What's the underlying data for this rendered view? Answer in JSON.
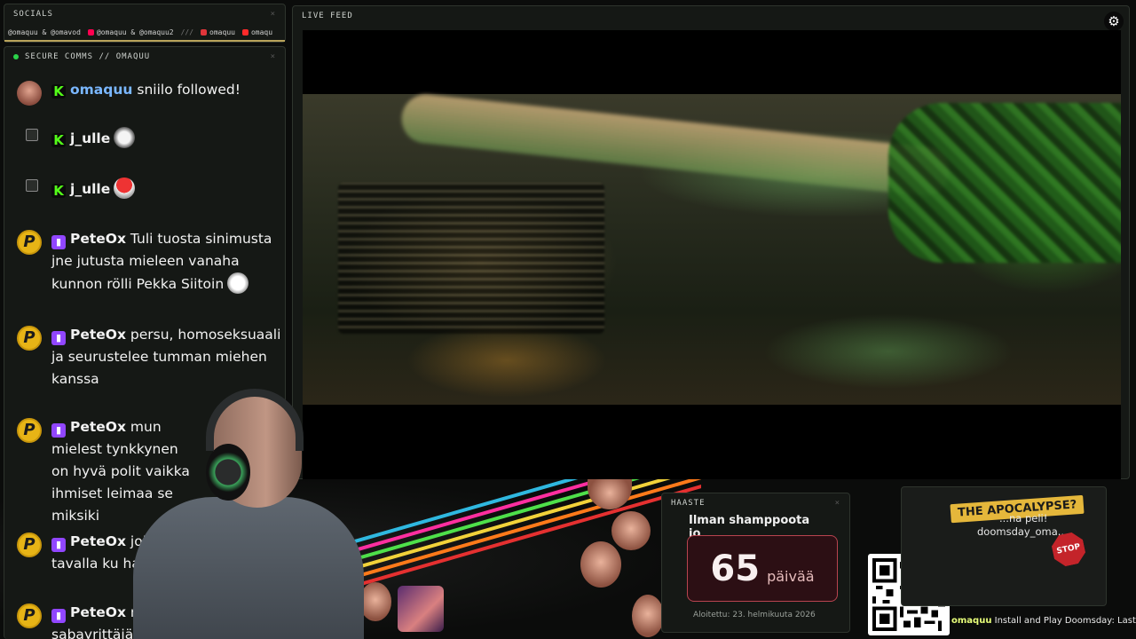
{
  "socials": {
    "title": "SOCIALS",
    "close": "×",
    "items": [
      {
        "label": "@omaquu & @omavod",
        "icon": "instagram-icon",
        "color": "#e1306c"
      },
      {
        "label": "@omaquu & @omaquu2",
        "icon": "tiktok-icon",
        "color": "#ff0050"
      },
      {
        "label": "///",
        "icon": "",
        "color": ""
      },
      {
        "label": "omaquu",
        "icon": "kick-icon",
        "color": "#e0353a"
      },
      {
        "label": "omaqu",
        "icon": "youtube-icon",
        "color": "#ff2a2a"
      }
    ]
  },
  "chat": {
    "title": "SECURE COMMS // OMAQUU",
    "close": "×",
    "messages": [
      {
        "user": "omaquu",
        "platform": "kick",
        "text": "sniilo followed!",
        "user_color": "#7ab7ff"
      },
      {
        "user": "j_ulle",
        "platform": "kick",
        "text": "",
        "emote": "ghost-emote"
      },
      {
        "user": "j_ulle",
        "platform": "kick",
        "text": "",
        "emote": "mushroom-emote"
      },
      {
        "user": "PeteOx",
        "platform": "twitch",
        "text": "Tuli tuosta sinimusta jne jutusta mieleen vanaha kunnon rölli Pekka Siitoin",
        "emote": "grin-emote"
      },
      {
        "user": "PeteOx",
        "platform": "twitch",
        "text": "persu, homoseksuaali ja seurustelee tumman miehen kanssa"
      },
      {
        "user": "PeteOx",
        "platform": "twitch",
        "text": "mun mielest tynkkynen on hyvä polit vaikka ihmiset leimaa se miksiki"
      },
      {
        "user": "PeteOx",
        "platform": "twitch",
        "text": "joka tavalla ku halm"
      },
      {
        "user": "PeteOx",
        "platform": "twitch",
        "text": "n sabayrittäjäl"
      }
    ]
  },
  "livefeed": {
    "title": "LIVE FEED",
    "settings_icon": "gear-icon"
  },
  "haaste": {
    "title": "HAASTE",
    "close": "×",
    "heading": "Ilman shamppoota jo",
    "count": "65",
    "unit": "päivää",
    "started": "Aloitettu: 23. helmikuuta 2026"
  },
  "promo": {
    "badge": "THE APOCALYPSE?",
    "line1": "...na peli!",
    "line2": "doomsday_oma...",
    "stop": "STOP"
  },
  "ticker": {
    "user": "omaquu",
    "text": "Install and Play Doomsday: Last Surv"
  },
  "colors": {
    "accent": "#b9a35a",
    "live": "#2bd34a",
    "kick": "#53fc18",
    "twitch": "#9146ff",
    "counter_border": "#b8444f"
  }
}
